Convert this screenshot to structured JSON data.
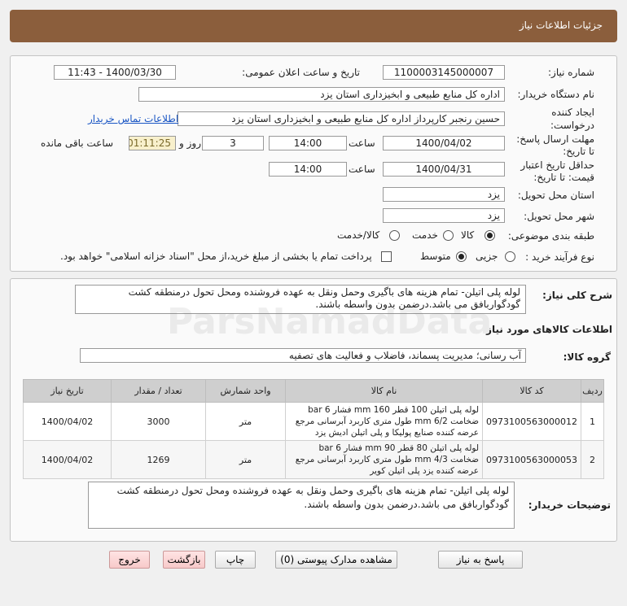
{
  "header": {
    "title": "جزئیات اطلاعات نیاز"
  },
  "form": {
    "need_number_label": "شماره نیاز:",
    "need_number": "1100003145000007",
    "announce_label": "تاریخ و ساعت اعلان عمومی:",
    "announce_value": "1400/03/30 - 11:43",
    "buyer_label": "نام دستگاه خریدار:",
    "buyer_value": "اداره کل منابع طبیعی و ابخیزداری استان یزد",
    "creator_label": "ایجاد کننده درخواست:",
    "creator_value": "حسین رنجبر کارپرداز اداره کل منابع طبیعی و ابخیزداری استان یزد",
    "contact_link": "اطلاعات تماس خریدار",
    "reply_deadline_label": "مهلت ارسال پاسخ: تا تاریخ:",
    "reply_date": "1400/04/02",
    "time_label": "ساعت",
    "reply_time": "14:00",
    "days_value": "3",
    "days_label": "روز و",
    "remaining_time": "01:11:25",
    "remaining_label": "ساعت باقی مانده",
    "validity_label": "حداقل تاریخ اعتبار قیمت: تا تاریخ:",
    "validity_date": "1400/04/31",
    "validity_time": "14:00",
    "province_label": "استان محل تحویل:",
    "province_value": "یزد",
    "city_label": "شهر محل تحویل:",
    "city_value": "یزد",
    "category_label": "طبقه بندی موضوعی:",
    "category_options": [
      "کالا",
      "خدمت",
      "کالا/خدمت"
    ],
    "process_label": "نوع فرآیند خرید :",
    "process_options": [
      "جزیی",
      "متوسط"
    ],
    "payment_note": "پرداخت تمام یا بخشی از مبلغ خرید،از محل \"اسناد خزانه اسلامی\" خواهد بود."
  },
  "summary": {
    "label": "شرح کلی نیاز:",
    "text": "لوله پلی اتیلن- تمام هزینه های باگیری وحمل ونقل به عهده فروشنده ومحل تحول درمنطقه کشت گودگواربافق می باشد.درضمن بدون واسطه باشند.",
    "items_title": "اطلاعات کالاهای مورد نیاز",
    "group_label": "گروه کالا:",
    "group_value": "آب رسانی؛ مدیریت پسماند، فاضلاب و فعالیت های تصفیه"
  },
  "table": {
    "headers": [
      "ردیف",
      "کد کالا",
      "نام کالا",
      "واحد شمارش",
      "تعداد / مقدار",
      "تاریخ نیاز"
    ],
    "rows": [
      {
        "row": "1",
        "code": "0973100563000012",
        "name": "لوله پلی اتیلن 100 قطر 160 mm فشار 6 bar ضخامت 6/2 mm طول متری کاربرد آبرسانی مرجع عرضه کننده صنایع پولیکا و پلی اتیلن ادیش یزد",
        "unit": "متر",
        "qty": "3000",
        "date": "1400/04/02"
      },
      {
        "row": "2",
        "code": "0973100563000053",
        "name": "لوله پلی اتیلن 80 قطر 90 mm فشار 6 bar ضخامت 4/3 mm طول متری کاربرد آبرسانی مرجع عرضه کننده یزد پلی اتیلن کویر",
        "unit": "متر",
        "qty": "1269",
        "date": "1400/04/02"
      }
    ]
  },
  "buyer_notes": {
    "label": "توضیحات خریدار:",
    "text": "لوله پلی اتیلن- تمام هزینه های باگیری وحمل ونقل به عهده فروشنده ومحل تحول درمنطقه کشت گودگواربافق می باشد.درضمن بدون واسطه باشند."
  },
  "buttons": {
    "reply": "پاسخ به نیاز",
    "attachments": "مشاهده مدارک پیوستی (0)",
    "print": "چاپ",
    "back": "بازگشت",
    "exit": "خروج"
  },
  "watermark": {
    "text": "ParsNamadData"
  },
  "colors": {
    "header_bg": "#8b5e3c",
    "link": "#1a56c4",
    "timer_bg": "#f8f0cc"
  }
}
